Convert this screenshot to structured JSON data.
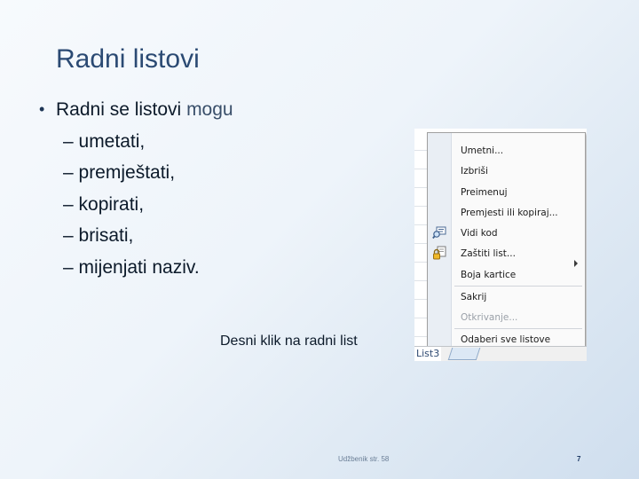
{
  "slide": {
    "title": "Radni listovi",
    "bullet_symbol": "•",
    "bullet_text_start": "Radni se listovi ",
    "bullet_text_accent": "mogu",
    "sub_items": [
      "– umetati,",
      "– premještati,",
      "– kopirati,",
      "– brisati,",
      "– mijenjati naziv."
    ],
    "caption": "Desni klik na radni list",
    "footer_left": "Udžbenik str. 58",
    "page_number": "7"
  },
  "context_menu": {
    "items": [
      {
        "label": "Umetni...",
        "enabled": true
      },
      {
        "label": "Izbriši",
        "enabled": true
      },
      {
        "label": "Preimenuj",
        "enabled": true
      },
      {
        "label": "Premjesti ili kopiraj...",
        "enabled": true
      },
      {
        "label": "Vidi kod",
        "enabled": true,
        "icon": "view-code-icon"
      },
      {
        "label": "Zaštiti list...",
        "enabled": true,
        "icon": "protect-sheet-icon"
      },
      {
        "label": "Boja kartice",
        "enabled": true,
        "has_submenu": true
      },
      {
        "label": "Sakrij",
        "enabled": true
      },
      {
        "label": "Otkrivanje...",
        "enabled": false
      },
      {
        "label": "Odaberi sve listove",
        "enabled": true
      }
    ],
    "sheet_tab": "List3"
  },
  "colors": {
    "title": "#2b4a73",
    "text": "#0c1a2a",
    "menu_gutter": "#e9eef4",
    "disabled_text": "#9aa0a8"
  }
}
